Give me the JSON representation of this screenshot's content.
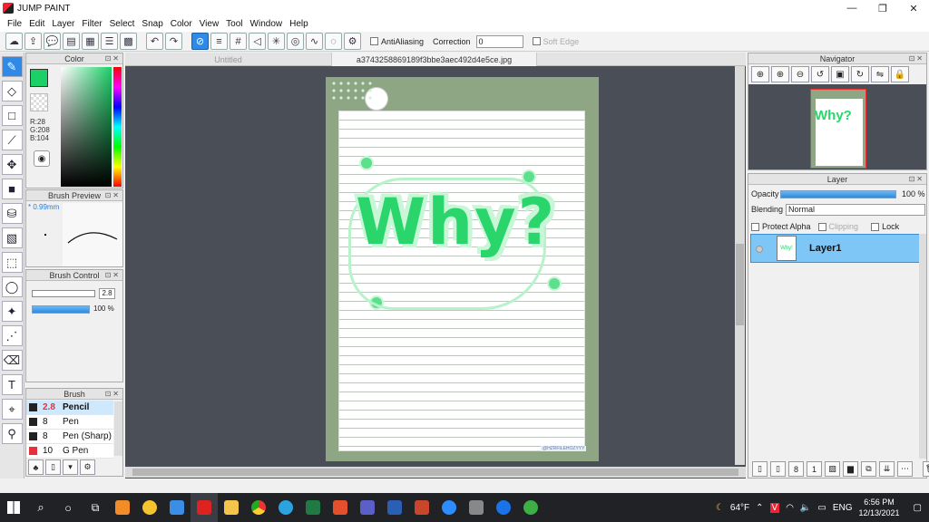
{
  "window": {
    "title": "JUMP PAINT",
    "minimize": "—",
    "maximize": "❐",
    "close": "✕"
  },
  "menu": [
    "File",
    "Edit",
    "Layer",
    "Filter",
    "Select",
    "Snap",
    "Color",
    "View",
    "Tool",
    "Window",
    "Help"
  ],
  "toolbar": {
    "antialiasing_label": "AntiAliasing",
    "correction_label": "Correction",
    "correction_value": "0",
    "soft_edge_label": "Soft Edge"
  },
  "color_panel": {
    "title": "Color",
    "r": "R:28",
    "g": "G:208",
    "b": "B:104",
    "foreground": "#1cd068"
  },
  "brush_preview": {
    "title": "Brush Preview",
    "size": "* 0.99mm"
  },
  "brush_control": {
    "title": "Brush Control",
    "size_value": "2.8",
    "opacity_value": "100 %",
    "opacity": 1.0
  },
  "brush_list": {
    "title": "Brush",
    "items": [
      {
        "size": "2.8",
        "name": "Pencil",
        "color": "#222222"
      },
      {
        "size": "8",
        "name": "Pen",
        "color": "#222222"
      },
      {
        "size": "8",
        "name": "Pen (Sharp)",
        "color": "#222222"
      },
      {
        "size": "10",
        "name": "G Pen",
        "color": "#e8303a"
      }
    ]
  },
  "doc_tabs": [
    "Untitled",
    "a3743258869189f3bbe3aec492d4e5ce.jpg"
  ],
  "artwork": {
    "text": "Why?",
    "signature": "@HZRFILEHOZYYY"
  },
  "navigator": {
    "title": "Navigator"
  },
  "layer_panel": {
    "title": "Layer",
    "opacity_label": "Opacity",
    "opacity_value": "100 %",
    "opacity": 1.0,
    "blending_label": "Blending",
    "blending_value": "Normal",
    "protect_alpha": "Protect Alpha",
    "clipping": "Clipping",
    "lock": "Lock",
    "layers": [
      {
        "name": "Layer1"
      }
    ],
    "thumb_text": "Why!"
  },
  "taskbar": {
    "weather": "64°F",
    "language": "ENG",
    "time": "6:56 PM",
    "date": "12/13/2021"
  }
}
